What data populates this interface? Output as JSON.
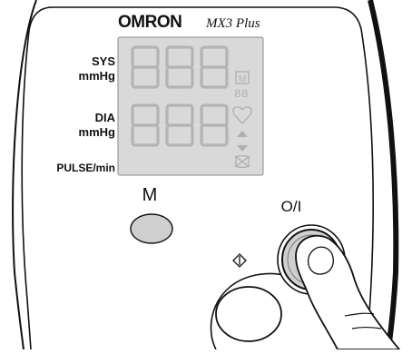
{
  "device": {
    "brand": "OMRON",
    "model": "MX3 Plus"
  },
  "display": {
    "sys_label_line1": "SYS",
    "sys_label_line2": "mmHg",
    "dia_label_line1": "DIA",
    "dia_label_line2": "mmHg",
    "pulse_label": "PULSE/min",
    "sys_digits": "888",
    "dia_digits": "888",
    "memory_indicator": "M",
    "memory_number": "88",
    "lcd_color": "#d9d9d9"
  },
  "buttons": {
    "memory_label": "M",
    "power_label": "O/I",
    "start_icon": "start-diamond-icon"
  },
  "colors": {
    "outline": "#111111",
    "segment": "#b4b4b4",
    "button_fill": "#cfcfcf"
  }
}
